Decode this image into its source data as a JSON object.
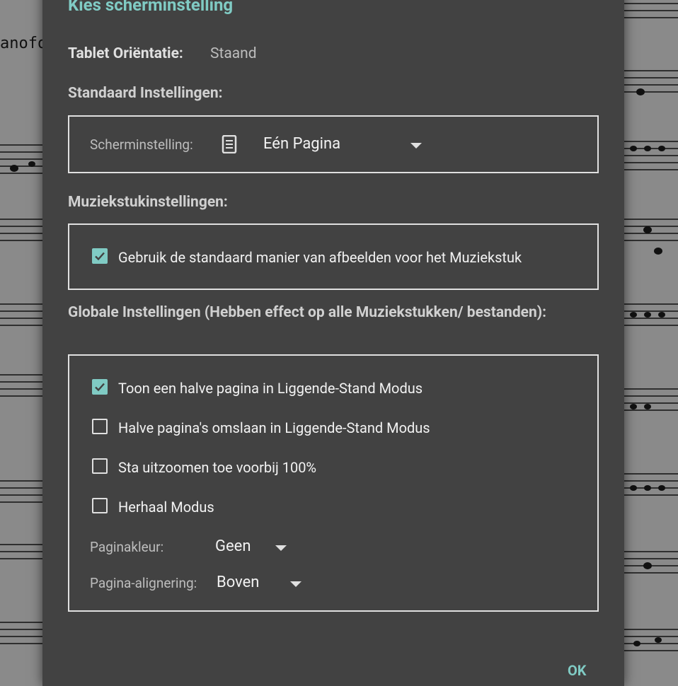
{
  "background": {
    "sheet_text": "anofo"
  },
  "dialog": {
    "title": "Kies scherminstelling",
    "orientation_label": "Tablet Oriëntatie:",
    "orientation_value": "Staand",
    "section_default": "Standaard Instellingen:",
    "screen_setting_label": "Scherminstelling:",
    "screen_setting_icon": "document-icon",
    "screen_setting_value": "Eén Pagina",
    "section_piece": "Muziekstukinstellingen:",
    "use_default_label": "Gebruik de standaard manier van afbeelden voor het Muziekstuk",
    "use_default_checked": true,
    "section_global": "Globale Instellingen (Hebben effect op alle Muziekstukken/ bestanden):",
    "global_options": [
      {
        "label": "Toon een halve pagina in Liggende-Stand Modus",
        "checked": true
      },
      {
        "label": "Halve pagina's omslaan in Liggende-Stand Modus",
        "checked": false
      },
      {
        "label": "Sta uitzoomen toe voorbij 100%",
        "checked": false
      },
      {
        "label": "Herhaal Modus",
        "checked": false
      }
    ],
    "page_color_label": "Paginakleur:",
    "page_color_value": "Geen",
    "page_align_label": "Pagina-alignering:",
    "page_align_value": "Boven",
    "ok_label": "OK"
  },
  "colors": {
    "accent": "#80cbc4",
    "dialog_bg": "#424242",
    "text": "#f2f2f2"
  }
}
